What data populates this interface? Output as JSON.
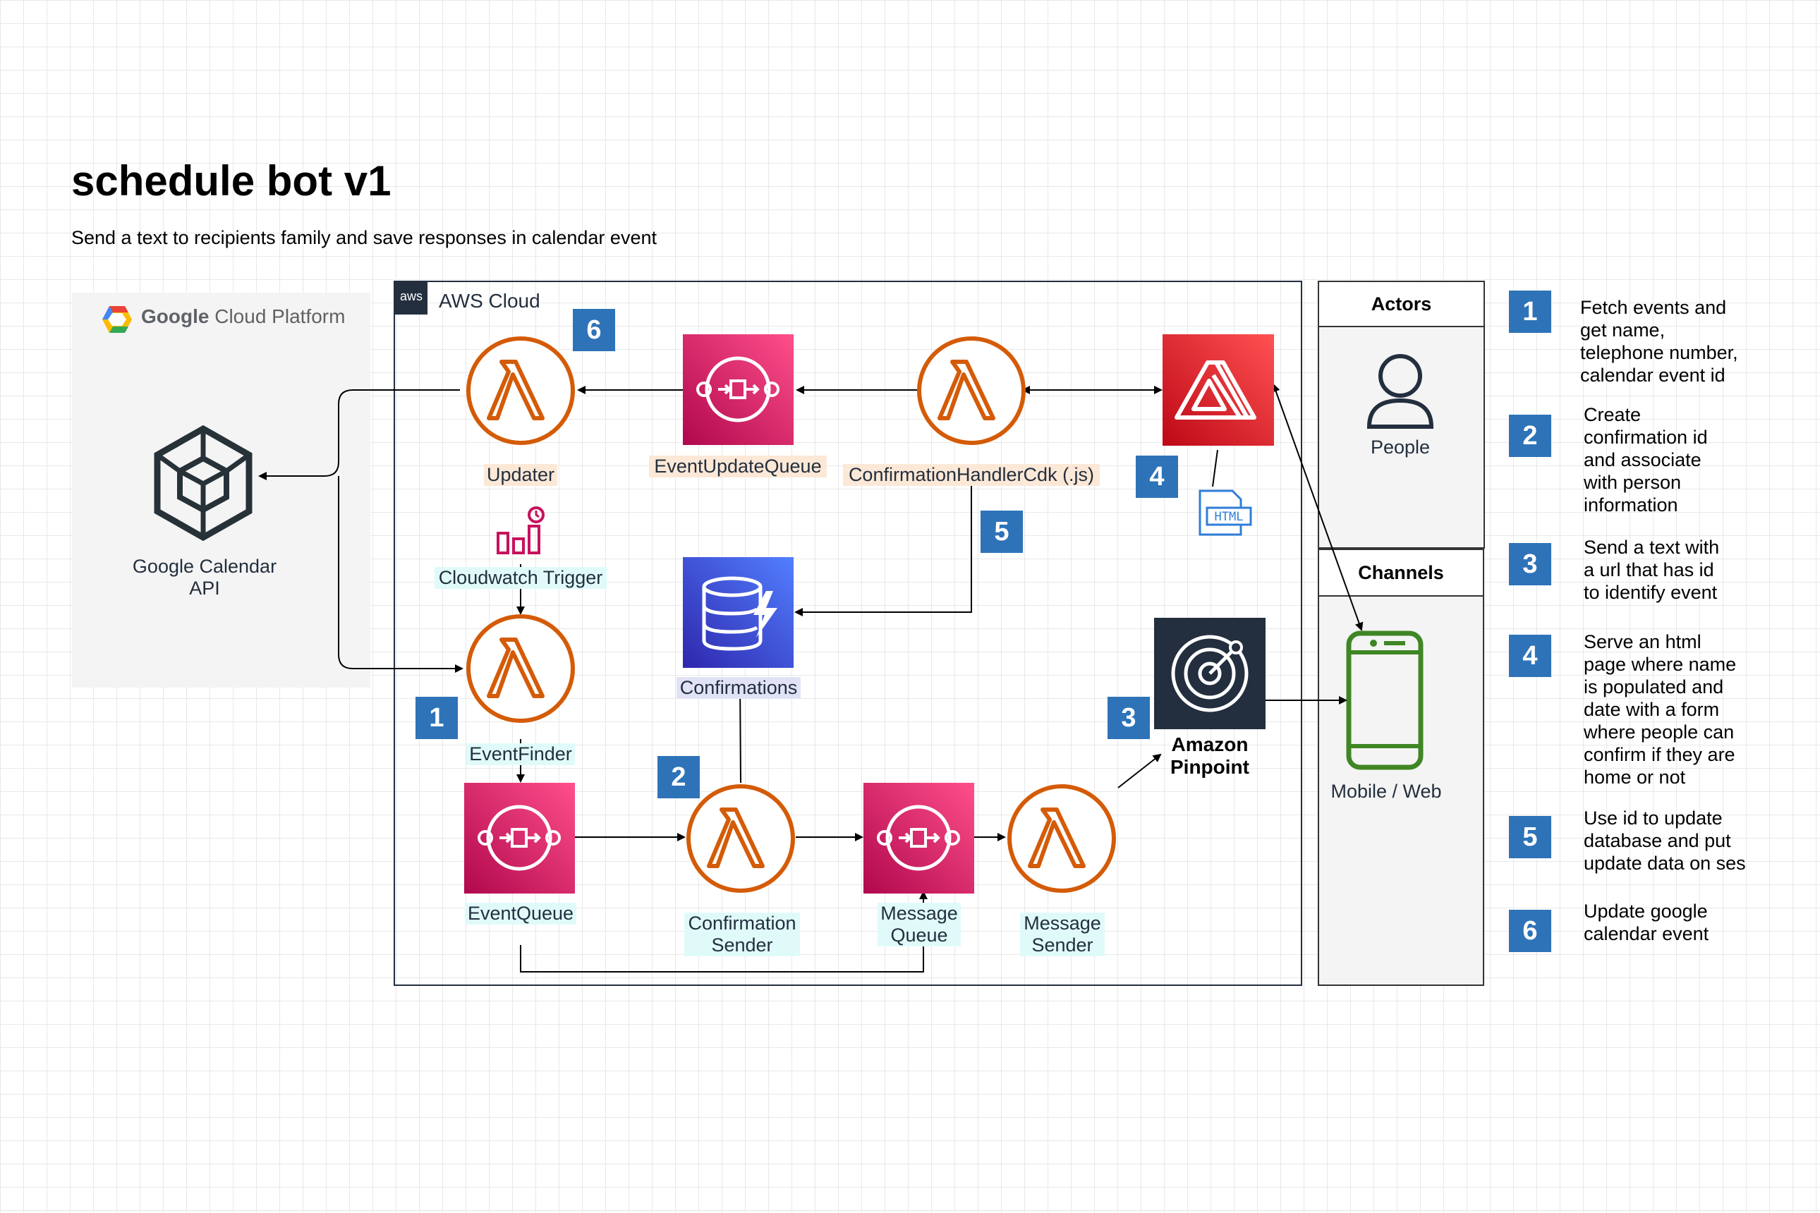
{
  "title": "schedule bot v1",
  "subtitle": "Send a text to recipients family and save responses in calendar event",
  "gcp": {
    "brand": "Google",
    "product": "Cloud Platform",
    "api_label": "Google Calendar\nAPI"
  },
  "aws": {
    "tag": "aws",
    "label": "AWS Cloud"
  },
  "nodes": {
    "updater": "Updater",
    "event_update_queue": "EventUpdateQueue",
    "confirmation_handler": "ConfirmationHandlerCdk (.js)",
    "cloudwatch_trigger": "Cloudwatch Trigger",
    "confirmations": "Confirmations",
    "event_finder": "EventFinder",
    "event_queue": "EventQueue",
    "confirmation_sender": "Confirmation\nSender",
    "message_queue": "Message\nQueue",
    "message_sender": "Message\nSender",
    "pinpoint": "Amazon\nPinpoint",
    "html_icon_text": "HTML"
  },
  "actors": {
    "title": "Actors",
    "people": "People"
  },
  "channels": {
    "title": "Channels",
    "mobile": "Mobile / Web"
  },
  "diagram_badges": [
    "1",
    "2",
    "3",
    "4",
    "5",
    "6"
  ],
  "steps": [
    {
      "num": "1",
      "text": "Fetch events and\nget name,\ntelephone number,\ncalendar event id"
    },
    {
      "num": "2",
      "text": "Create\nconfirmation id\nand associate\nwith person\ninformation"
    },
    {
      "num": "3",
      "text": "Send a text with\na url that has id\nto identify event"
    },
    {
      "num": "4",
      "text": "Serve an html\npage where name\nis populated and\ndate with a form\nwhere people can\nconfirm if they are\nhome or not"
    },
    {
      "num": "5",
      "text": "Use id to update\ndatabase and put\nupdate data on ses"
    },
    {
      "num": "6",
      "text": "Update google\ncalendar event"
    }
  ],
  "colors": {
    "lambda": "#d45b07",
    "sqs": "#e7157b",
    "dynamo": "#3b48cc",
    "amplify": "#dd344c",
    "pinpoint": "#232f3e",
    "badge": "#2e73b8",
    "mobile": "#3f8624"
  }
}
